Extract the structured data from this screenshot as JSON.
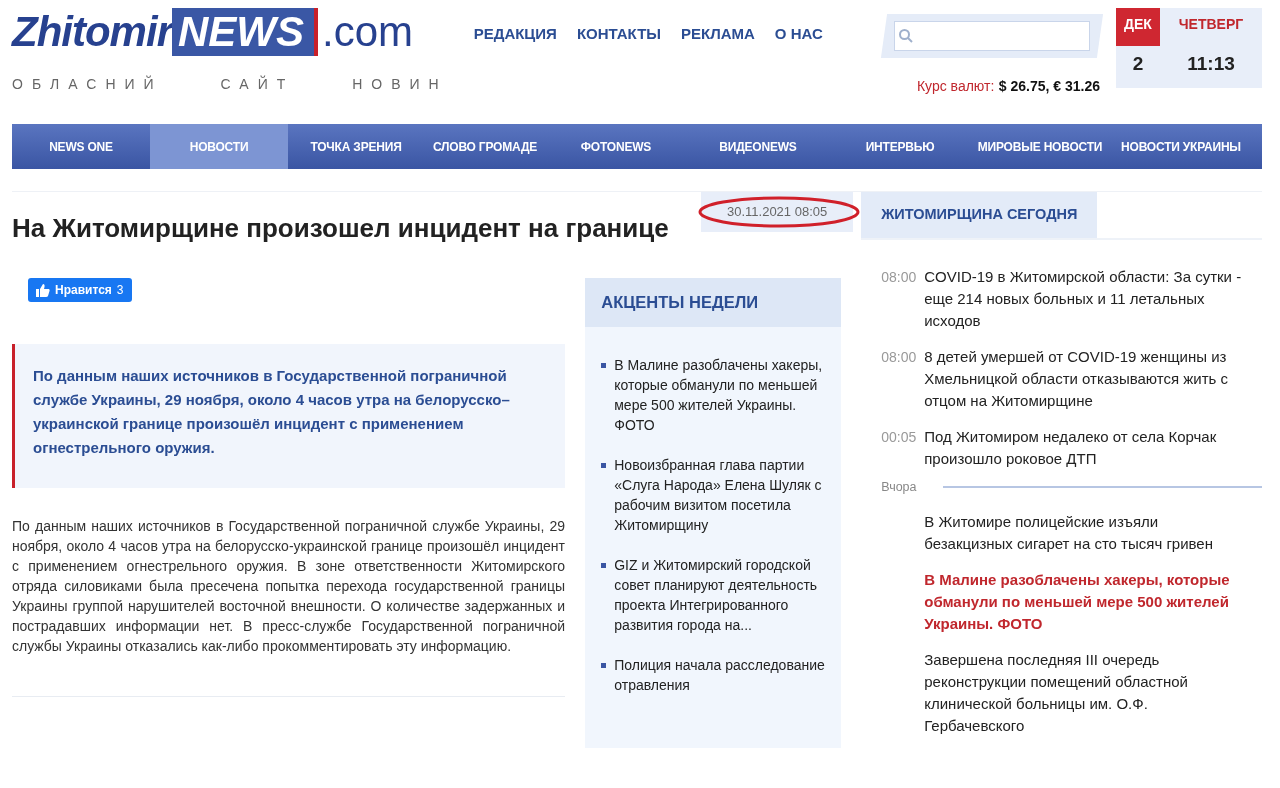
{
  "logo": {
    "part_1": "Zhitomir",
    "part_2": "NEWS",
    "part_3": ".com",
    "tagline": "ОБЛАСНИЙ САЙТ НОВИН"
  },
  "top_links": [
    "РЕДАКЦИЯ",
    "КОНТАКТЫ",
    "РЕКЛАМА",
    "О НАС"
  ],
  "currency": {
    "label": "Курс валют:",
    "value": "$ 26.75, € 31.26"
  },
  "date_widget": {
    "month": "ДЕК",
    "weekday": "ЧЕТВЕРГ",
    "day": "2",
    "time": "11:13"
  },
  "nav": [
    {
      "label": "NEWS ONE",
      "selected": false
    },
    {
      "label": "НОВОСТИ",
      "selected": true
    },
    {
      "label": "ТОЧКА ЗРЕНИЯ",
      "selected": false
    },
    {
      "label": "СЛОВО ГРОМАДЕ",
      "selected": false
    },
    {
      "label": "ФОТОNEWS",
      "selected": false
    },
    {
      "label": "ВИДЕОNEWS",
      "selected": false
    },
    {
      "label": "ИНТЕРВЬЮ",
      "selected": false
    },
    {
      "label": "МИРОВЫЕ НОВОСТИ",
      "selected": false
    },
    {
      "label": "НОВОСТИ УКРАИНЫ",
      "selected": false
    }
  ],
  "article": {
    "title": "На Житомирщине произошел инцидент на границе",
    "date": "30.11.2021 08:05",
    "date_circled": true,
    "like": {
      "label": "Нравится",
      "count": "3"
    },
    "lead": "По данным наших источников в Государственной пограничной службе Украины, 29 ноября, около 4 часов утра на белорусско–украинской границе произошёл инцидент с применением огнестрельного оружия.",
    "body": "По данным наших источников в Государственной пограничной службе Украины, 29 ноября, около 4 часов утра на белорусско-украинской границе произошёл инцидент с применением огнестрельного оружия. В зоне ответственности Житомирского отряда силовиками была пресечена попытка перехода государственной границы Украины группой нарушителей восточной внешности. О количестве задержанных и пострадавших информации нет. В пресс-службе Государственной пограничной службы Украины отказались как-либо прокомментировать эту информацию."
  },
  "accents": {
    "title": "АКЦЕНТЫ НЕДЕЛИ",
    "items": [
      "В Малине разоблачены хакеры, которые обманули по меньшей мере 500 жителей Украины. ФОТО",
      "Новоизбранная глава партии «Слуга Народа» Елена Шуляк с рабочим визитом посетила Житомирщину",
      "GIZ и Житомирский городской совет планируют деятельность проекта Интегрированного развития города на...",
      "Полиция начала расследование отравления"
    ]
  },
  "today": {
    "title": "ЖИТОМИРЩИНА СЕГОДНЯ",
    "items": [
      {
        "kind": "news",
        "time": "08:00",
        "text": "COVID-19 в Житомирской области: За сутки - еще 214 новых больных и 11 летальных исходов",
        "highlighted": false
      },
      {
        "kind": "news",
        "time": "08:00",
        "text": "8 детей умершей от COVID-19 женщины из Хмельницкой области отказываются жить с отцом на Житомирщине",
        "highlighted": false
      },
      {
        "kind": "news",
        "time": "00:05",
        "text": "Под Житомиром недалеко от села Корчак произошло роковое ДТП",
        "highlighted": false
      },
      {
        "kind": "day",
        "label": "Вчора"
      },
      {
        "kind": "news",
        "text": "В Житомире полицейские изъяли безакцизных сигарет на сто тысяч гривен",
        "highlighted": false
      },
      {
        "kind": "news",
        "text": "В Малине разоблачены хакеры, которые обманули по меньшей мере 500 жителей Украины. ФОТО",
        "highlighted": true
      },
      {
        "kind": "news",
        "text": "Завершена последняя III очередь реконструкции помещений областной клинической больницы им. О.Ф. Гербачевского",
        "highlighted": false
      }
    ]
  }
}
